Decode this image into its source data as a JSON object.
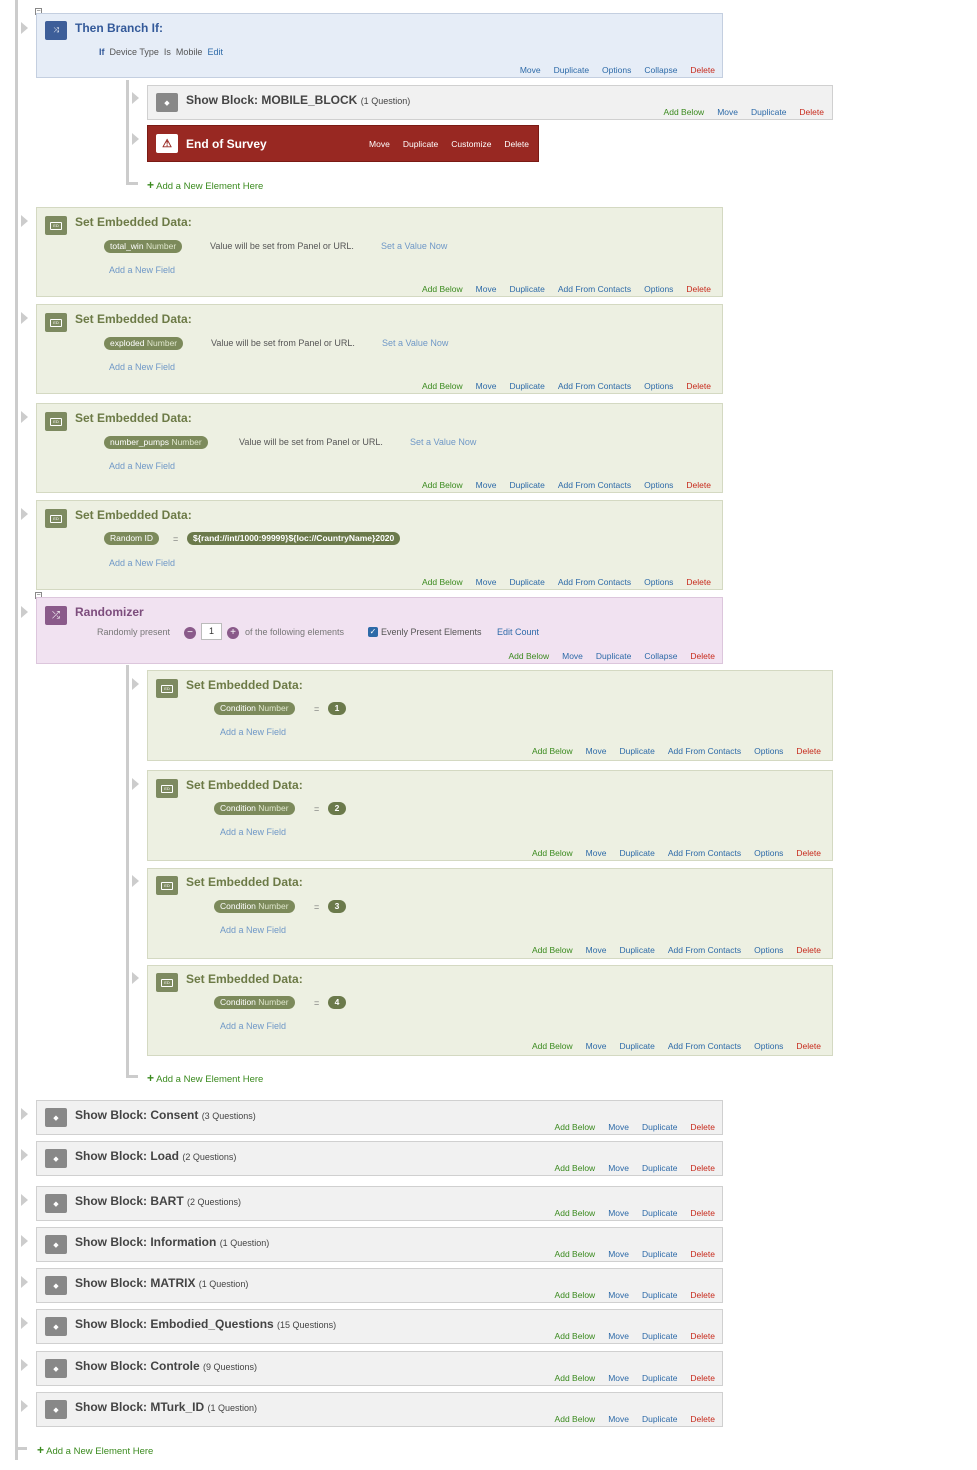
{
  "branch": {
    "title": "Then Branch If:",
    "if_label": "If",
    "condition": "Device Type",
    "op": "Is",
    "value": "Mobile",
    "edit": "Edit",
    "actions": [
      "Move",
      "Duplicate",
      "Options",
      "Collapse",
      "Delete"
    ]
  },
  "mobile_block": {
    "title": "Show Block: MOBILE_BLOCK",
    "count": "(1 Question)",
    "actions": [
      "Add Below",
      "Move",
      "Duplicate",
      "Delete"
    ]
  },
  "end_survey": {
    "title": "End of Survey",
    "actions": [
      "Move",
      "Duplicate",
      "Customize",
      "Delete"
    ]
  },
  "add_new_element": "Add a New Element Here",
  "embedded_title": "Set Embedded Data:",
  "panel_text": "Value will be set from Panel or URL.",
  "set_value_now": "Set a Value Now",
  "add_new_field": "Add a New Field",
  "type_number": "Number",
  "equals": "=",
  "ed_actions": [
    "Add Below",
    "Move",
    "Duplicate",
    "Add From Contacts",
    "Options",
    "Delete"
  ],
  "embedded": [
    {
      "field": "total_win"
    },
    {
      "field": "exploded"
    },
    {
      "field": "number_pumps"
    },
    {
      "field": "Random ID",
      "value": "${rand://int/1000:99999}${loc://CountryName}2020"
    }
  ],
  "randomizer": {
    "title": "Randomizer",
    "present": "Randomly present",
    "count": "1",
    "following": "of the following elements",
    "evenly": "Evenly Present Elements",
    "edit_count": "Edit Count",
    "actions": [
      "Add Below",
      "Move",
      "Duplicate",
      "Collapse",
      "Delete"
    ]
  },
  "conditions": [
    {
      "field": "Condition",
      "value": "1"
    },
    {
      "field": "Condition",
      "value": "2"
    },
    {
      "field": "Condition",
      "value": "3"
    },
    {
      "field": "Condition",
      "value": "4"
    }
  ],
  "show_actions": [
    "Add Below",
    "Move",
    "Duplicate",
    "Delete"
  ],
  "blocks": [
    {
      "prefix": "Show Block: ",
      "name": "Consent",
      "count": "(3 Questions)"
    },
    {
      "prefix": "Show Block: ",
      "name": "Load",
      "count": "(2 Questions)"
    },
    {
      "prefix": "Show Block: ",
      "name": "BART",
      "count": "(2 Questions)"
    },
    {
      "prefix": "Show Block: ",
      "name": "Information",
      "count": "(1 Question)"
    },
    {
      "prefix": "Show Block: ",
      "name": "MATRIX",
      "count": "(1 Question)"
    },
    {
      "prefix": "Show Block: ",
      "name": "Embodied_Questions",
      "count": "(15 Questions)"
    },
    {
      "prefix": "Show Block: ",
      "name": "Controle",
      "count": "(9 Questions)"
    },
    {
      "prefix": "Show Block: ",
      "name": "MTurk_ID",
      "count": "(1 Question)"
    }
  ],
  "icons": {
    "branch": "branch-icon",
    "embedded": "embedded-data-icon",
    "randomizer": "shuffle-icon",
    "block": "cube-icon",
    "warning": "warning-icon",
    "plus": "plus-icon",
    "minus": "minus-icon",
    "check": "checkbox-icon"
  },
  "colors": {
    "blue_bg": "#e6edf7",
    "green_bg": "#edf0e2",
    "pink_bg": "#f1e2f1",
    "end_red": "#982822",
    "add_green": "#3a8a1e",
    "link_blue": "#2d6aa8",
    "delete_red": "#c72a1c"
  }
}
